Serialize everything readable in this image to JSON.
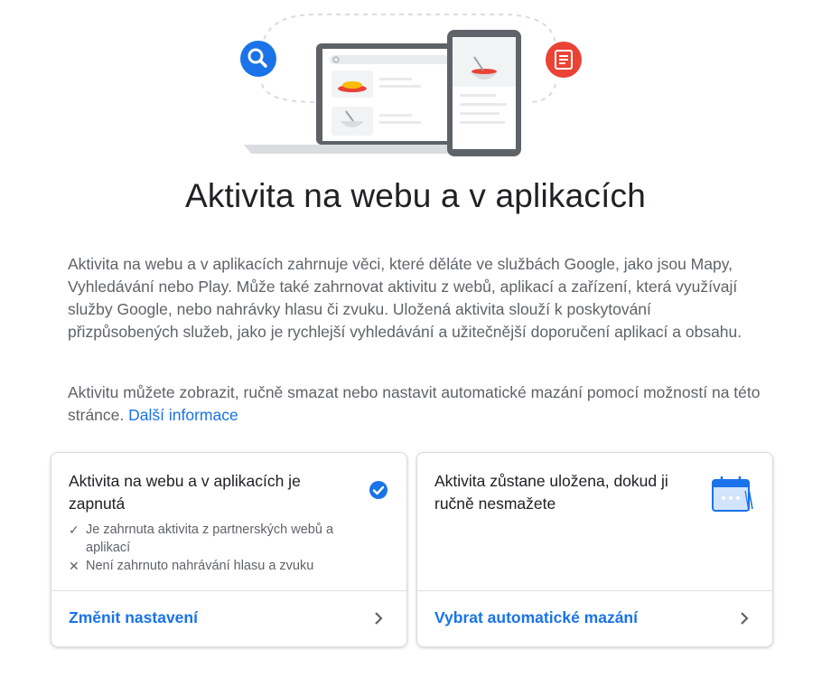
{
  "page": {
    "title": "Aktivita na webu a v aplikacích",
    "description_1": "Aktivita na webu a v aplikacích zahrnuje věci, které děláte ve službách Google, jako jsou Mapy, Vyhledávání nebo Play. Může také zahrnovat aktivitu z webů, aplikací a zařízení, která využívají služby Google, nebo nahrávky hlasu či zvuku. Uložená aktivita slouží k poskytování přizpůsobených služeb, jako je rychlejší vyhledávání a užitečnější doporučení aplikací a obsahu.",
    "description_2": "Aktivitu můžete zobrazit, ručně smazat nebo nastavit automatické mazání pomocí možností na této stránce.",
    "more_info_link": "Další informace"
  },
  "hero": {
    "icons": [
      "search-icon",
      "article-icon",
      "laptop-illustration",
      "phone-illustration"
    ],
    "colors": {
      "search": "#1a73e8",
      "article": "#ea4335"
    }
  },
  "cards": {
    "activity_status": {
      "title": "Aktivita na webu a v aplikacích je zapnutá",
      "status_icon": "check-circle-icon",
      "items": [
        {
          "icon": "check-icon",
          "text": "Je zahrnuta aktivita z partnerských webů a aplikací"
        },
        {
          "icon": "close-icon",
          "text": "Není zahrnuto nahrávání hlasu a zvuku"
        }
      ],
      "action_label": "Změnit nastavení"
    },
    "auto_delete": {
      "title": "Aktivita zůstane uložena, dokud ji ručně nesmažete",
      "status_icon": "calendar-icon",
      "action_label": "Vybrat automatické mazání"
    }
  },
  "colors": {
    "accent": "#1a73e8",
    "text": "#202124",
    "secondary_text": "#5f6368"
  }
}
